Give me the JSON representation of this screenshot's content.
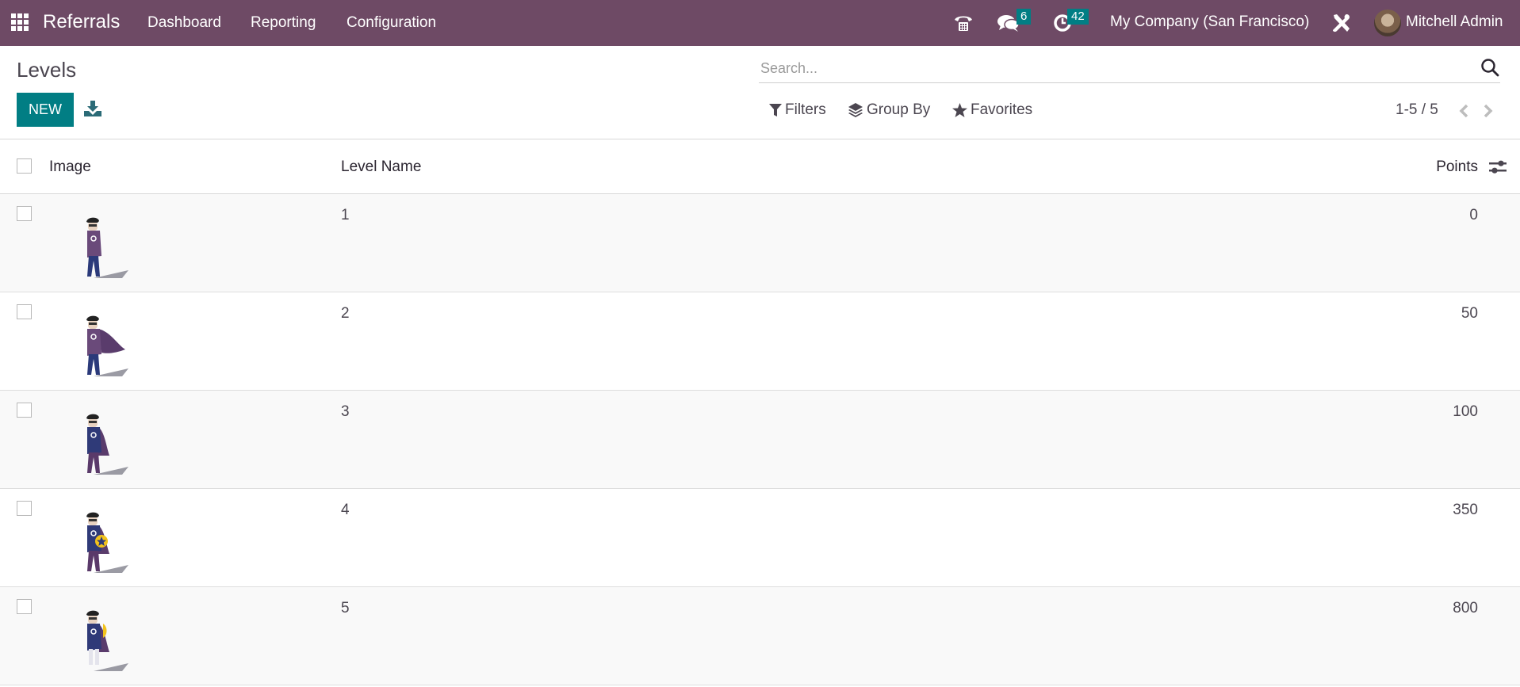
{
  "navbar": {
    "app_name": "Referrals",
    "menus": [
      "Dashboard",
      "Reporting",
      "Configuration"
    ],
    "icons": {
      "apps": "apps-grid-icon",
      "phone": "phone-icon",
      "messages": "chat-bubbles-icon",
      "activities": "clock-icon",
      "debug": "tools-icon"
    },
    "messages_count": "6",
    "activities_count": "42",
    "company": "My Company (San Francisco)",
    "user": "Mitchell Admin"
  },
  "control_panel": {
    "title": "Levels",
    "new_label": "NEW",
    "download_icon": "download-icon",
    "search_placeholder": "Search...",
    "search_value": "",
    "filters_label": "Filters",
    "group_by_label": "Group By",
    "favorites_label": "Favorites",
    "pager": "1-5 / 5"
  },
  "table": {
    "columns": {
      "image": "Image",
      "level_name": "Level Name",
      "points": "Points"
    },
    "rows": [
      {
        "image": "hero-level-1",
        "level_name": "1",
        "points": "0"
      },
      {
        "image": "hero-level-2",
        "level_name": "2",
        "points": "50"
      },
      {
        "image": "hero-level-3",
        "level_name": "3",
        "points": "100"
      },
      {
        "image": "hero-level-4",
        "level_name": "4",
        "points": "350"
      },
      {
        "image": "hero-level-5",
        "level_name": "5",
        "points": "800"
      }
    ]
  },
  "colors": {
    "navbar": "#6e4a65",
    "primary": "#017e84",
    "badge": "#017e84",
    "row_alt": "#f9f9f9"
  }
}
